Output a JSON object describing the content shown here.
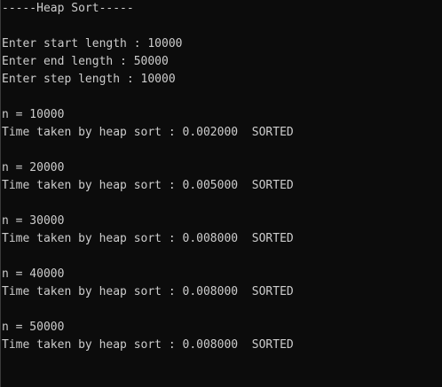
{
  "console": {
    "header": "-----Heap Sort-----",
    "prompts": [
      "Enter start length : 10000",
      "Enter end length : 50000",
      "Enter step length : 10000"
    ],
    "results": [
      {
        "n_line": "n = 10000",
        "time_line": "Time taken by heap sort : 0.002000  SORTED"
      },
      {
        "n_line": "n = 20000",
        "time_line": "Time taken by heap sort : 0.005000  SORTED"
      },
      {
        "n_line": "n = 30000",
        "time_line": "Time taken by heap sort : 0.008000  SORTED"
      },
      {
        "n_line": "n = 40000",
        "time_line": "Time taken by heap sort : 0.008000  SORTED"
      },
      {
        "n_line": "n = 50000",
        "time_line": "Time taken by heap sort : 0.008000  SORTED"
      }
    ]
  },
  "colors": {
    "background": "#0c0c0c",
    "text": "#cccccc"
  }
}
